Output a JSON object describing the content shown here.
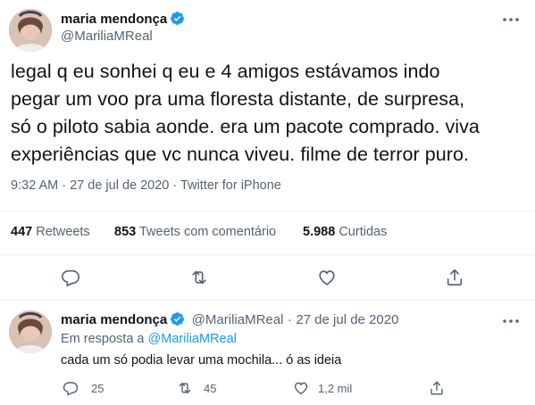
{
  "tweet": {
    "author_name": "maria mendonça",
    "author_handle": "@MariliaMReal",
    "text_lines": [
      "legal q eu sonhei q eu e 4 amigos estávamos indo",
      "pegar um voo pra uma floresta distante, de surpresa,",
      "só o piloto sabia aonde. era um pacote comprado. viva",
      "experiências que vc nunca viveu. filme de terror puro."
    ],
    "time": "9:32 AM",
    "date": "27 de jul de 2020",
    "separator": "·",
    "source": "Twitter for iPhone",
    "stats": {
      "retweets_count": "447",
      "retweets_label": "Retweets",
      "quotes_count": "853",
      "quotes_label": "Tweets com comentário",
      "likes_count": "5.988",
      "likes_label": "Curtidas"
    }
  },
  "reply": {
    "author_name": "maria mendonça",
    "author_handle": "@MariliaMReal",
    "separator": "·",
    "date": "27 de jul de 2020",
    "in_reply_prefix": "Em resposta a",
    "in_reply_handle": "@MariliaMReal",
    "text": "cada um só podia levar uma mochila... ó as ideia",
    "replies_count": "25",
    "retweets_count": "45",
    "likes_count": "1,2 mil"
  },
  "colors": {
    "accent": "#1d9bf0",
    "secondary_text": "#536471",
    "divider": "#eff3f4"
  },
  "icons": {
    "verified": "verified-badge-icon",
    "more": "more-dots-icon",
    "reply": "reply-icon",
    "retweet": "retweet-icon",
    "like": "heart-icon",
    "share": "share-icon"
  }
}
